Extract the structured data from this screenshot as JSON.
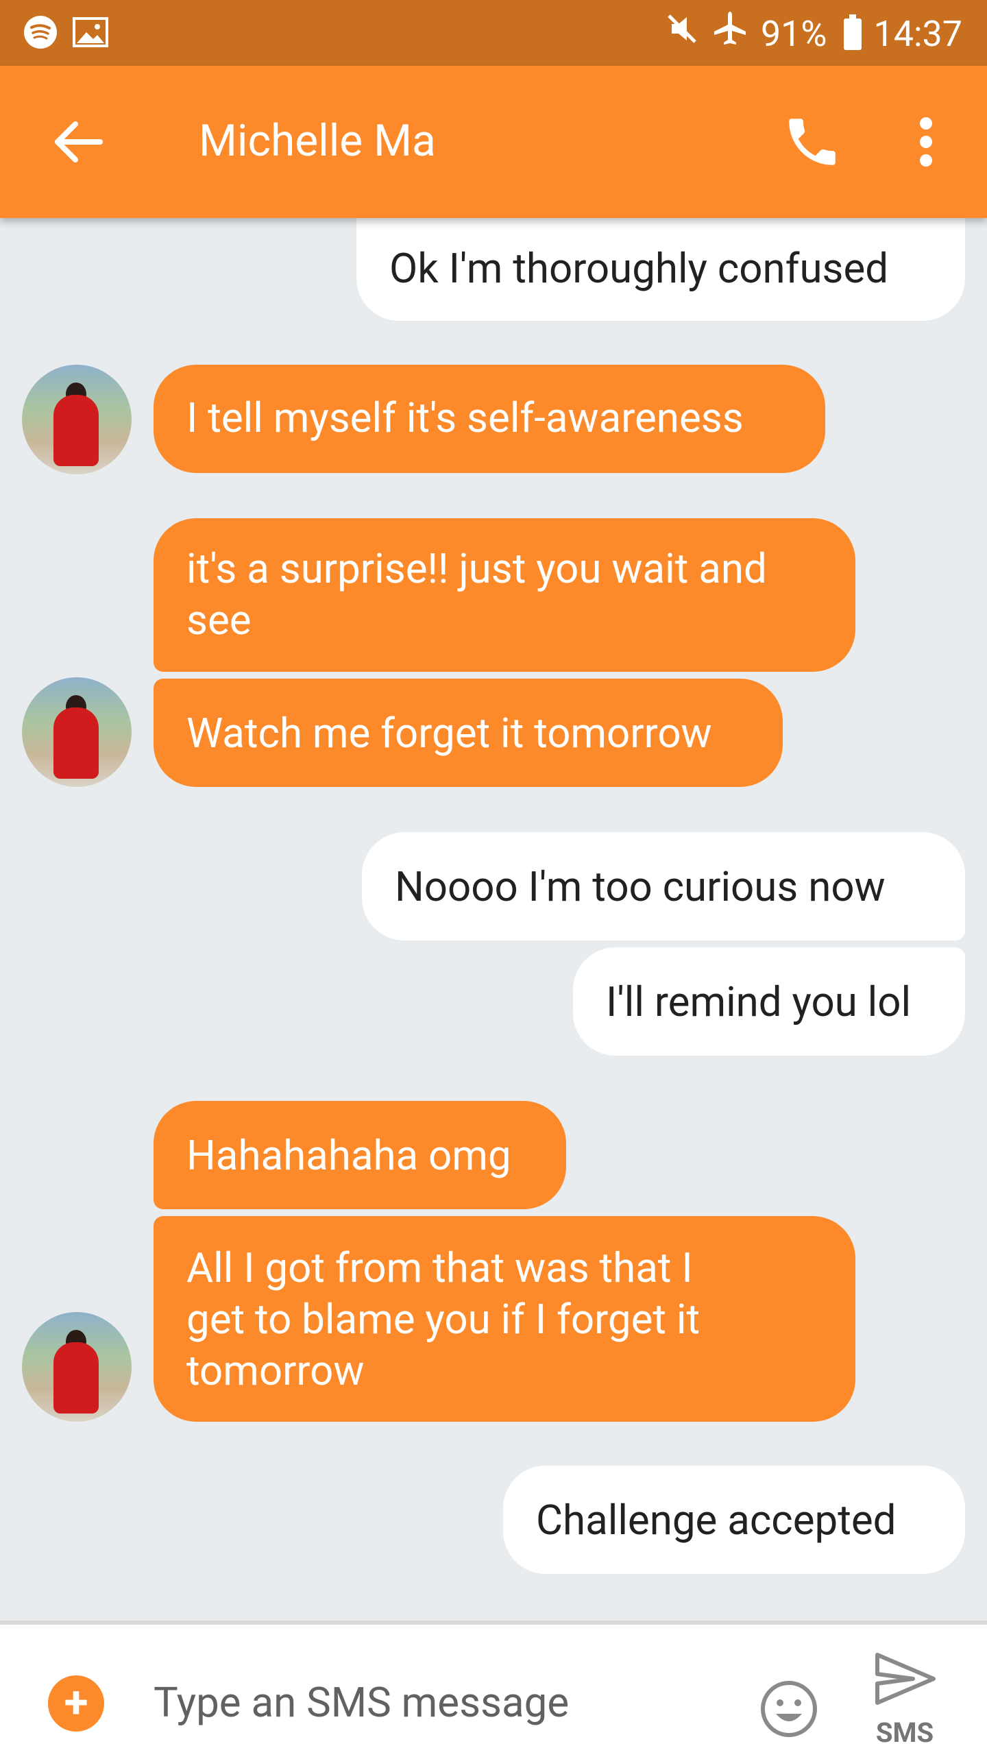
{
  "status_bar": {
    "battery": "91%",
    "time": "14:37"
  },
  "header": {
    "contact_name": "Michelle Ma"
  },
  "messages": [
    {
      "from": "me",
      "text": "Ok I'm thoroughly confused"
    },
    {
      "from": "contact",
      "text": "I tell myself it's self-awareness"
    },
    {
      "from": "contact",
      "text": "it's a surprise!! just you wait and see"
    },
    {
      "from": "contact",
      "text": "Watch me forget it tomorrow"
    },
    {
      "from": "me",
      "text": "Noooo I'm too curious now"
    },
    {
      "from": "me",
      "text": "I'll remind you lol"
    },
    {
      "from": "contact",
      "text": "Hahahahaha omg"
    },
    {
      "from": "contact",
      "text": "All I got from that was that I get to blame you if I forget it tomorrow"
    },
    {
      "from": "me",
      "text": "Challenge accepted"
    }
  ],
  "composer": {
    "placeholder": "Type an SMS message",
    "send_label": "SMS"
  },
  "colors": {
    "status_bar": "#c8701f",
    "app_bar": "#fd8a2a",
    "incoming_bubble": "#fd8a2a",
    "outgoing_bubble": "#ffffff",
    "background": "#e9ecef"
  },
  "icons": [
    "spotify-icon",
    "image-icon",
    "mute-icon",
    "airplane-icon",
    "battery-icon",
    "back-arrow-icon",
    "phone-icon",
    "more-vert-icon",
    "add-icon",
    "emoji-icon",
    "send-icon"
  ]
}
